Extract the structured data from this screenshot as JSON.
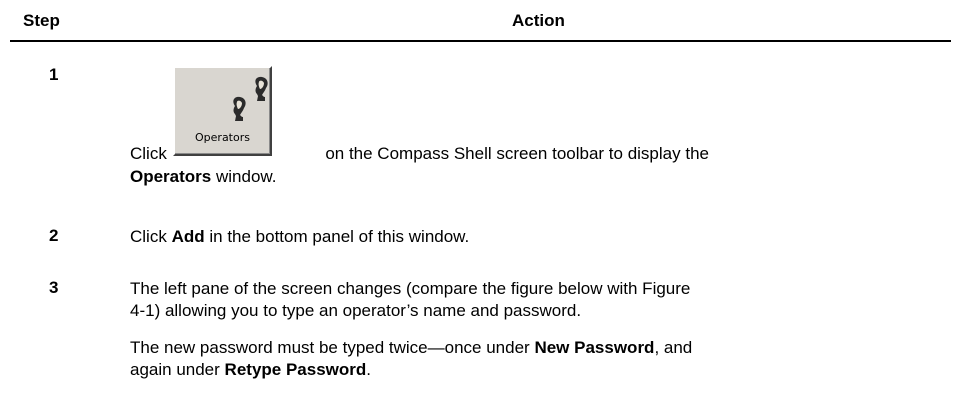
{
  "header": {
    "step": "Step",
    "action": "Action"
  },
  "step1": {
    "number": "1",
    "click": "Click",
    "button": {
      "label": "Operators",
      "icon": "operators-icon"
    },
    "after_button": "on the Compass Shell screen toolbar to display the",
    "window_name": "Operators",
    "window_suffix": "window."
  },
  "step2": {
    "number": "2",
    "click": "Click",
    "add": "Add",
    "rest": "in the bottom panel of this window."
  },
  "step3": {
    "number": "3",
    "line1": "The left pane of the screen changes (compare the figure below with Figure",
    "line2": "4-1) allowing you to type an operator’s name and password.",
    "para2_a": "The new password must be typed twice—once under",
    "new_password": "New Password",
    "para2_b": ", and",
    "para2_c": "again under",
    "retype_password": "Retype Password",
    "para2_d": "."
  }
}
